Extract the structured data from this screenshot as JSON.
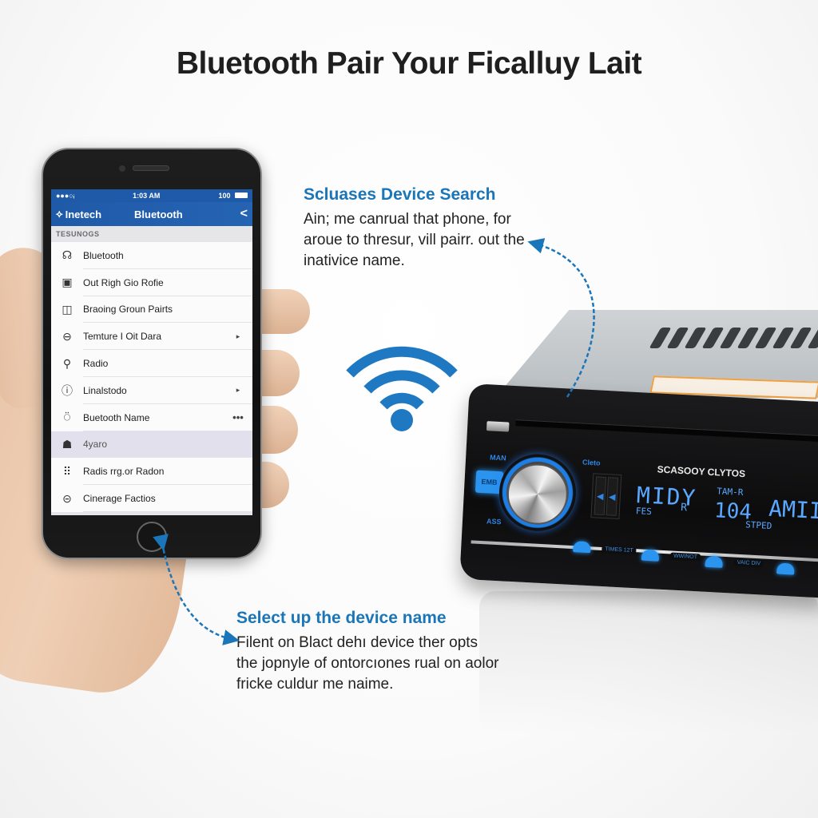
{
  "page": {
    "title": "Bluetooth Pair Your Ficalluy Lait"
  },
  "phone": {
    "status_bar": {
      "signal": "●●●○ᵢ",
      "time": "1:03 AM",
      "battery": "100"
    },
    "nav": {
      "back_label": "Inetech",
      "title": "Bluetooth"
    },
    "section_header": "TESUNOGS",
    "items": [
      {
        "icon": "bluetooth-device-icon",
        "glyph": "☊",
        "label": "Bluetooth",
        "accessory": ""
      },
      {
        "icon": "document-icon",
        "glyph": "▣",
        "label": "Out Righ Gio Rofie",
        "accessory": ""
      },
      {
        "icon": "book-icon",
        "glyph": "◫",
        "label": "Braoing Groun Pairts",
        "accessory": ""
      },
      {
        "icon": "user-icon",
        "glyph": "⊖",
        "label": "Temture I Oit Dara",
        "accessory": "▸"
      },
      {
        "icon": "search-icon",
        "glyph": "⚲",
        "label": "Radio",
        "accessory": ""
      },
      {
        "icon": "info-circle-icon",
        "glyph": "ⓘ",
        "label": "Linalstodo",
        "accessory": "▸"
      },
      {
        "icon": "location-pin-icon",
        "glyph": "⍥",
        "label": "Buetooth Name",
        "accessory": "•••"
      },
      {
        "icon": "group-icon",
        "glyph": "☗",
        "label": "4yaro",
        "accessory": "",
        "selected": true
      },
      {
        "icon": "grid-icon",
        "glyph": "⠿",
        "label": "Radis rrg.or Radon",
        "accessory": ""
      },
      {
        "icon": "minus-circle-icon",
        "glyph": "⊝",
        "label": "Cinerage Factios",
        "accessory": ""
      }
    ]
  },
  "callouts": {
    "top": {
      "heading": "Scluases Device Search",
      "body": "Ain; me canrual that phone, for aroue to thresur, vill pairr. out the inativice name."
    },
    "bottom": {
      "heading": "Select up the device name",
      "body": "Filent on Blact dehı device ther opts the jopnyle of ontorcıones rual on aolor fricke culdur me naime."
    }
  },
  "stereo": {
    "brand": "SCASOOY CLYTOS",
    "left_top_label": "MAN",
    "eq_button": "EMB",
    "left_bottom_label": "ASS",
    "source_label": "Cleto",
    "seek_left": "◀",
    "seek_right": "◀",
    "display_main": "MIDY",
    "display_sub": "FES",
    "display_r": "R",
    "display_band": "TAM-R",
    "display_freq": "104",
    "display_mode": "STPED",
    "display_right": "AMII",
    "strip_labels": [
      "TIMES 12T",
      "WWINOT",
      "VAIC DIV"
    ]
  },
  "colors": {
    "accent_blue": "#1a76b8",
    "phone_header": "#1f5aa8",
    "stereo_glow": "#2a94ee"
  }
}
